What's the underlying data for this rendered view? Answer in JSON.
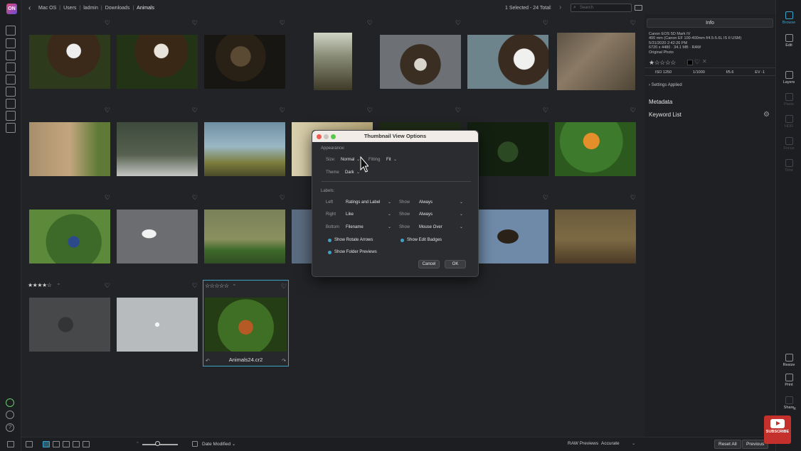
{
  "breadcrumb": [
    "Mac OS",
    "Users",
    "ladmin",
    "Downloads",
    "Animals"
  ],
  "selection_info": "1 Selected - 24 Total",
  "search_placeholder": "Search",
  "grid": {
    "selected_rating": "☆☆☆☆☆",
    "rated_item_stars": "★★★★☆",
    "selected_filename": "Animals24.cr2"
  },
  "right_panel": {
    "tab": "Info",
    "camera": [
      "Canon EOS 5D Mark IV",
      "400 mm (Canon EF 100-400mm f/4.5-5.6L IS II USM)",
      "5/31/2020 2:42:26 PM",
      "6720 x 4480 · 34.1 MB · RAW",
      "Original Photo"
    ],
    "stars": "★☆☆☆☆",
    "exif": [
      "ISO 1250",
      "1/1000",
      "f/5.6",
      "EV -1"
    ],
    "settings_applied": "Settings Applied",
    "metadata": "Metadata",
    "keyword_list": "Keyword List"
  },
  "tools_right": {
    "browse": "Browse",
    "edit": "Edit",
    "layers": "Layers",
    "paste": "Paste",
    "hdr": "HDR",
    "focus": "Focus",
    "time": "Time",
    "resize": "Resize",
    "print": "Print",
    "share": "Share",
    "export_partial": "rt"
  },
  "bottom": {
    "sort": "Date Modified",
    "raw_previews_label": "RAW Previews",
    "raw_previews_value": "Accurate",
    "reset_all": "Reset All",
    "previous": "Previous"
  },
  "dialog": {
    "title": "Thumbnail View Options",
    "appearance": "Appearance:",
    "size_label": "Size:",
    "size_value": "Normal",
    "fitting_label": "Fitting",
    "fitting_value": "Fit",
    "theme_label": "Theme",
    "theme_value": "Dark",
    "labels_heading": "Labels:",
    "rows": [
      {
        "pos": "Left",
        "value": "Ratings and Label",
        "show_label": "Show",
        "show": "Always"
      },
      {
        "pos": "Right",
        "value": "Like",
        "show_label": "Show",
        "show": "Always"
      },
      {
        "pos": "Bottom",
        "value": "Filename",
        "show_label": "Show",
        "show": "Mouse Over"
      }
    ],
    "show_rotate": "Show Rotate Arrows",
    "show_edit_badges": "Show Edit Badges",
    "show_folder_previews": "Show Folder Previews",
    "cancel": "Cancel",
    "ok": "OK"
  },
  "youtube_badge": "SUBSCRIBE"
}
